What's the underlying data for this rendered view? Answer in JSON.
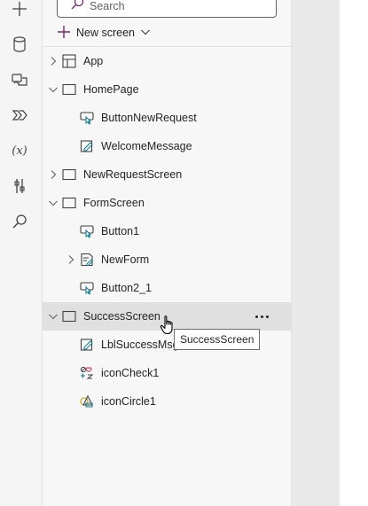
{
  "search": {
    "placeholder": "Search"
  },
  "toolbar": {
    "new_screen_label": "New screen"
  },
  "rail": {
    "icons": [
      "plus-icon",
      "database-icon",
      "media-icon",
      "flow-icon",
      "variable-icon",
      "tools-icon",
      "search-icon"
    ],
    "variable_glyph": "(x)"
  },
  "tree": {
    "items": [
      {
        "label": "App",
        "type": "app",
        "expandable": true,
        "expanded": false
      },
      {
        "label": "HomePage",
        "type": "screen",
        "expandable": true,
        "expanded": true
      },
      {
        "label": "ButtonNewRequest",
        "type": "button"
      },
      {
        "label": "WelcomeMessage",
        "type": "label"
      },
      {
        "label": "NewRequestScreen",
        "type": "screen",
        "expandable": true,
        "expanded": false
      },
      {
        "label": "FormScreen",
        "type": "screen",
        "expandable": true,
        "expanded": true
      },
      {
        "label": "Button1",
        "type": "button"
      },
      {
        "label": "NewForm",
        "type": "form",
        "expandable": true,
        "expanded": false
      },
      {
        "label": "Button2_1",
        "type": "button"
      },
      {
        "label": "SuccessScreen",
        "type": "screen",
        "expandable": true,
        "expanded": true,
        "selected": true
      },
      {
        "label": "LblSuccessMsg",
        "type": "label"
      },
      {
        "label": "iconCheck1",
        "type": "icon"
      },
      {
        "label": "iconCircle1",
        "type": "icon"
      }
    ]
  },
  "tooltip": {
    "text": "SuccessScreen"
  },
  "colors": {
    "accent": "#742774",
    "teal": "#0f7b8c",
    "selected_row": "#e0e0e0"
  }
}
